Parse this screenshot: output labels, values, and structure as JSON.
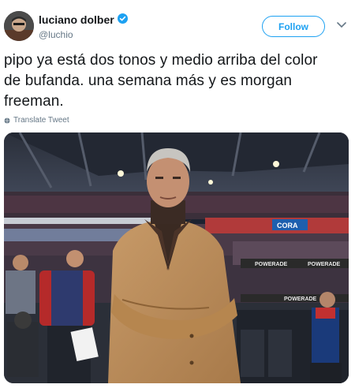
{
  "tweet": {
    "author_name": "luciano dolber",
    "author_handle": "@luchio",
    "follow_label": "Follow",
    "text": "pipo ya está dos tonos y medio arriba del color de bufanda. una semana más y es morgan freeman.",
    "translate_label": "Translate Tweet"
  },
  "photo": {
    "banner_texts": [
      "POWERADE",
      "POWERADE",
      "POWERADE"
    ],
    "ad_text": "CORA"
  },
  "colors": {
    "accent": "#1da1f2",
    "secondary_text": "#657786"
  },
  "icons": {
    "verified": "verified-badge-icon",
    "caret": "chevron-down-icon",
    "translate": "globe-icon"
  }
}
